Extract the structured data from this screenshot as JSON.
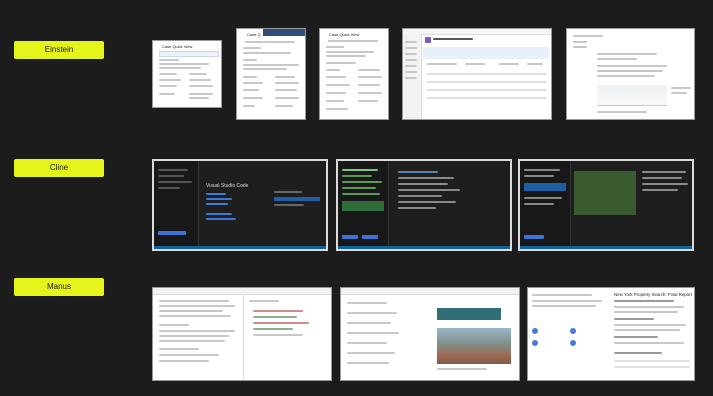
{
  "rows": [
    {
      "label": "Einstein"
    },
    {
      "label": "Cline"
    },
    {
      "label": "Manus"
    }
  ],
  "thumbs": {
    "einstein_1_title": "Case Quick View",
    "einstein_2_title": "Case Q",
    "einstein_3_title": "Case Quick View",
    "cline_1_title": "Visual Studio Code",
    "manus_3_title": "New York Property Search: Final Report"
  }
}
